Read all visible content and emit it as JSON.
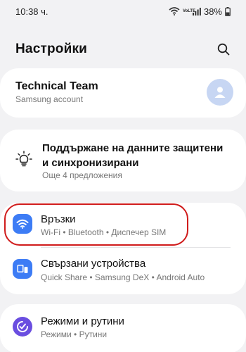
{
  "status": {
    "time": "10:38 ч.",
    "volte": "VoLTE",
    "battery": "38%"
  },
  "header": {
    "title": "Настройки"
  },
  "account": {
    "name": "Technical Team",
    "subtitle": "Samsung account"
  },
  "sync": {
    "title": "Поддържане на данните защитени и синхронизирани",
    "subtitle": "Още 4 предложения"
  },
  "items": [
    {
      "title": "Връзки",
      "subtitle": "Wi-Fi • Bluetooth • Диспечер SIM",
      "icon": "wifi-icon",
      "color": "#3d7cf5"
    },
    {
      "title": "Свързани устройства",
      "subtitle": "Quick Share • Samsung DeX • Android Auto",
      "icon": "connected-devices-icon",
      "color": "#3d7cf5"
    },
    {
      "title": "Режими и рутини",
      "subtitle": "Режими • Рутини",
      "icon": "modes-routines-icon",
      "color": "#6a4ee0"
    }
  ],
  "colors": {
    "highlight": "#d01c1c",
    "background": "#f2f2f4"
  }
}
